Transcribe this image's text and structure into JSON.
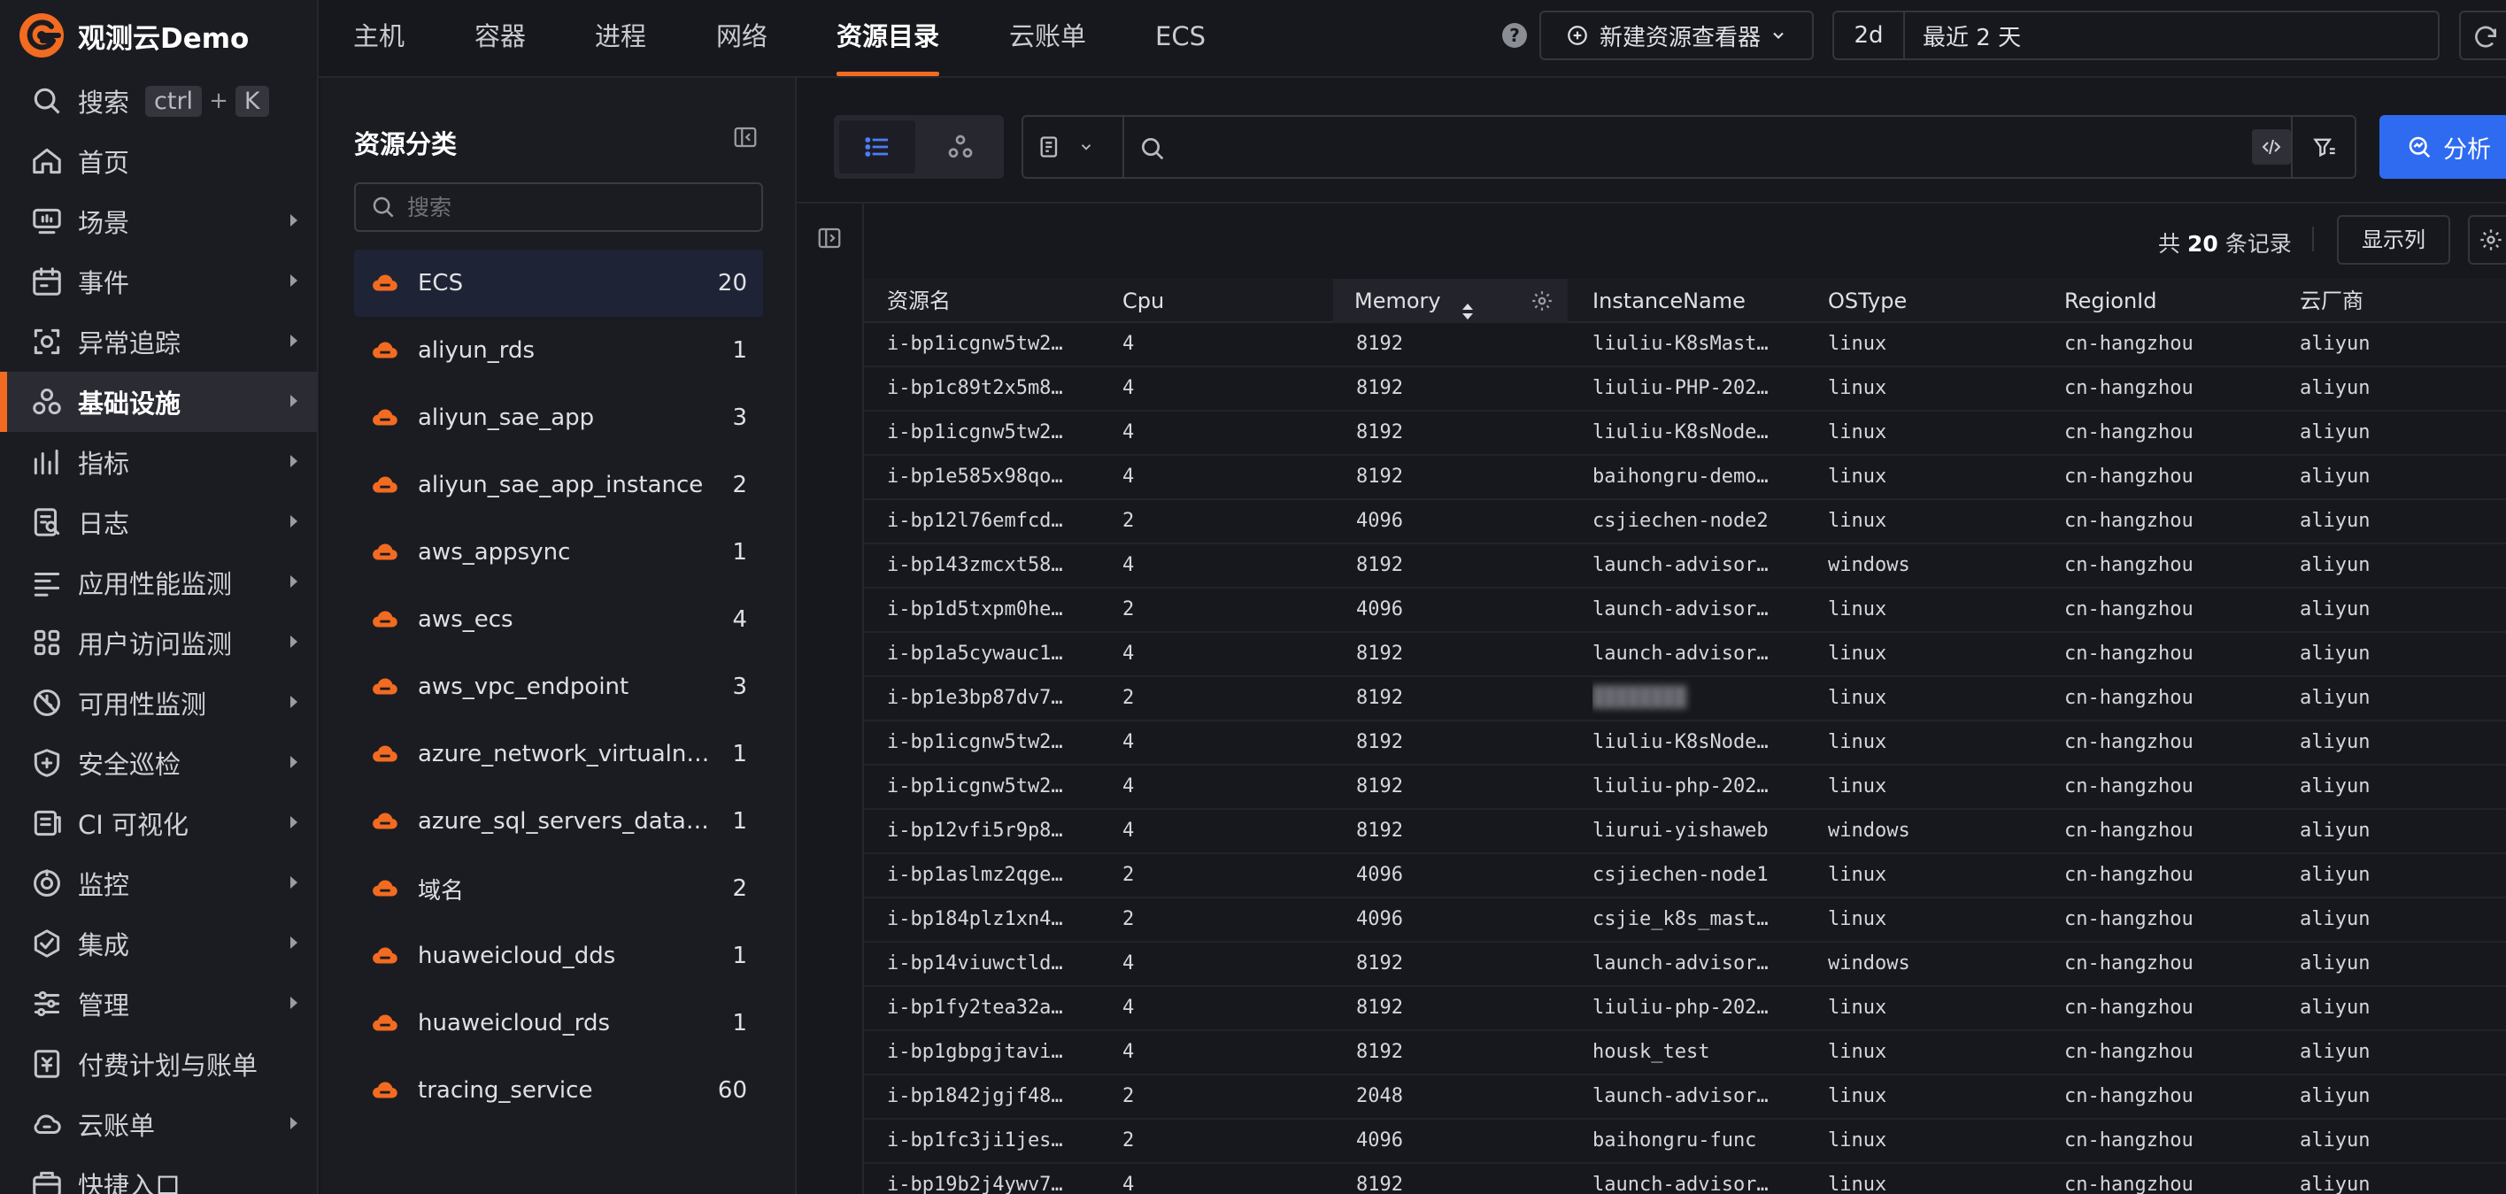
{
  "brand": {
    "name": "观测云Demo"
  },
  "nav": {
    "search_label": "搜索",
    "shortcut_key1": "ctrl",
    "shortcut_plus": "+",
    "shortcut_key2": "K",
    "items": [
      {
        "label": "首页",
        "icon": "home-icon",
        "arrow": false
      },
      {
        "label": "场景",
        "icon": "dashboard-icon",
        "arrow": true
      },
      {
        "label": "事件",
        "icon": "calendar-icon",
        "arrow": true
      },
      {
        "label": "异常追踪",
        "icon": "bug-scan-icon",
        "arrow": true
      },
      {
        "label": "基础设施",
        "icon": "infrastructure-icon",
        "arrow": true,
        "active": true
      },
      {
        "label": "指标",
        "icon": "metrics-icon",
        "arrow": true
      },
      {
        "label": "日志",
        "icon": "log-icon",
        "arrow": true
      },
      {
        "label": "应用性能监测",
        "icon": "apm-icon",
        "arrow": true
      },
      {
        "label": "用户访问监测",
        "icon": "rum-icon",
        "arrow": true
      },
      {
        "label": "可用性监测",
        "icon": "availability-icon",
        "arrow": true
      },
      {
        "label": "安全巡检",
        "icon": "shield-icon",
        "arrow": true
      },
      {
        "label": "CI 可视化",
        "icon": "ci-icon",
        "arrow": true
      },
      {
        "label": "监控",
        "icon": "monitor-icon",
        "arrow": true
      },
      {
        "label": "集成",
        "icon": "integration-icon",
        "arrow": true
      },
      {
        "label": "管理",
        "icon": "settings-sliders-icon",
        "arrow": true
      },
      {
        "label": "付费计划与账单",
        "icon": "billing-icon",
        "arrow": false
      },
      {
        "label": "云账单",
        "icon": "cloud-bill-icon",
        "arrow": true
      },
      {
        "label": "快捷入口",
        "icon": "shortcut-icon",
        "arrow": false
      }
    ]
  },
  "tabs": [
    "主机",
    "容器",
    "进程",
    "网络",
    "资源目录",
    "云账单",
    "ECS"
  ],
  "active_tab": "资源目录",
  "header": {
    "help_glyph": "?",
    "new_viewer_label": "新建资源查看器",
    "time_short": "2d",
    "time_long": "最近 2 天"
  },
  "categories": {
    "title": "资源分类",
    "search_placeholder": "搜索",
    "items": [
      {
        "name": "ECS",
        "count": "20",
        "active": true
      },
      {
        "name": "aliyun_rds",
        "count": "1"
      },
      {
        "name": "aliyun_sae_app",
        "count": "3"
      },
      {
        "name": "aliyun_sae_app_instance",
        "count": "2"
      },
      {
        "name": "aws_appsync",
        "count": "1"
      },
      {
        "name": "aws_ecs",
        "count": "4"
      },
      {
        "name": "aws_vpc_endpoint",
        "count": "3"
      },
      {
        "name": "azure_network_virtualnet...",
        "count": "1"
      },
      {
        "name": "azure_sql_servers_databas...",
        "count": "1"
      },
      {
        "name": "域名",
        "count": "2"
      },
      {
        "name": "huaweicloud_dds",
        "count": "1"
      },
      {
        "name": "huaweicloud_rds",
        "count": "1"
      },
      {
        "name": "tracing_service",
        "count": "60"
      }
    ]
  },
  "query": {
    "placeholder": "",
    "analyze_label": "分析"
  },
  "records": {
    "prefix": "共",
    "count": "20",
    "suffix": "条记录"
  },
  "columns_button_label": "显示列",
  "table": {
    "headers": [
      "资源名",
      "Cpu",
      "Memory",
      "InstanceName",
      "OSType",
      "RegionId",
      "云厂商"
    ],
    "sorted_column": "Memory",
    "rows": [
      [
        "i-bp1icgnw5tw2…",
        "4",
        "8192",
        "liuliu-K8sMast…",
        "linux",
        "cn-hangzhou",
        "aliyun"
      ],
      [
        "i-bp1c89t2x5m8…",
        "4",
        "8192",
        "liuliu-PHP-202…",
        "linux",
        "cn-hangzhou",
        "aliyun"
      ],
      [
        "i-bp1icgnw5tw2…",
        "4",
        "8192",
        "liuliu-K8sNode…",
        "linux",
        "cn-hangzhou",
        "aliyun"
      ],
      [
        "i-bp1e585x98qo…",
        "4",
        "8192",
        "baihongru-demo…",
        "linux",
        "cn-hangzhou",
        "aliyun"
      ],
      [
        "i-bp12l76emfcd…",
        "2",
        "4096",
        "csjiechen-node2",
        "linux",
        "cn-hangzhou",
        "aliyun"
      ],
      [
        "i-bp143zmcxt58…",
        "4",
        "8192",
        "launch-advisor…",
        "windows",
        "cn-hangzhou",
        "aliyun"
      ],
      [
        "i-bp1d5txpm0he…",
        "2",
        "4096",
        "launch-advisor…",
        "linux",
        "cn-hangzhou",
        "aliyun"
      ],
      [
        "i-bp1a5cywauc1…",
        "4",
        "8192",
        "launch-advisor…",
        "linux",
        "cn-hangzhou",
        "aliyun"
      ],
      [
        "i-bp1e3bp87dv7…",
        "2",
        "8192",
        "",
        "linux",
        "cn-hangzhou",
        "aliyun"
      ],
      [
        "i-bp1icgnw5tw2…",
        "4",
        "8192",
        "liuliu-K8sNode…",
        "linux",
        "cn-hangzhou",
        "aliyun"
      ],
      [
        "i-bp1icgnw5tw2…",
        "4",
        "8192",
        "liuliu-php-202…",
        "linux",
        "cn-hangzhou",
        "aliyun"
      ],
      [
        "i-bp12vfi5r9p8…",
        "4",
        "8192",
        "liurui-yishaweb",
        "windows",
        "cn-hangzhou",
        "aliyun"
      ],
      [
        "i-bp1aslmz2qge…",
        "2",
        "4096",
        "csjiechen-node1",
        "linux",
        "cn-hangzhou",
        "aliyun"
      ],
      [
        "i-bp184plz1xn4…",
        "2",
        "4096",
        "csjie_k8s_mast…",
        "linux",
        "cn-hangzhou",
        "aliyun"
      ],
      [
        "i-bp14viuwctld…",
        "4",
        "8192",
        "launch-advisor…",
        "windows",
        "cn-hangzhou",
        "aliyun"
      ],
      [
        "i-bp1fy2tea32a…",
        "4",
        "8192",
        "liuliu-php-202…",
        "linux",
        "cn-hangzhou",
        "aliyun"
      ],
      [
        "i-bp1gbpgjtavi…",
        "4",
        "8192",
        "housk_test",
        "linux",
        "cn-hangzhou",
        "aliyun"
      ],
      [
        "i-bp1842jgjf48…",
        "2",
        "2048",
        "launch-advisor…",
        "linux",
        "cn-hangzhou",
        "aliyun"
      ],
      [
        "i-bp1fc3ji1jes…",
        "2",
        "4096",
        "baihongru-func",
        "linux",
        "cn-hangzhou",
        "aliyun"
      ],
      [
        "i-bp19b2j4ywv7…",
        "4",
        "8192",
        "launch-advisor…",
        "linux",
        "cn-hangzhou",
        "aliyun"
      ]
    ]
  },
  "colors": {
    "accent": "#f26b21",
    "primary": "#2f6bf0",
    "background": "#16171c"
  }
}
